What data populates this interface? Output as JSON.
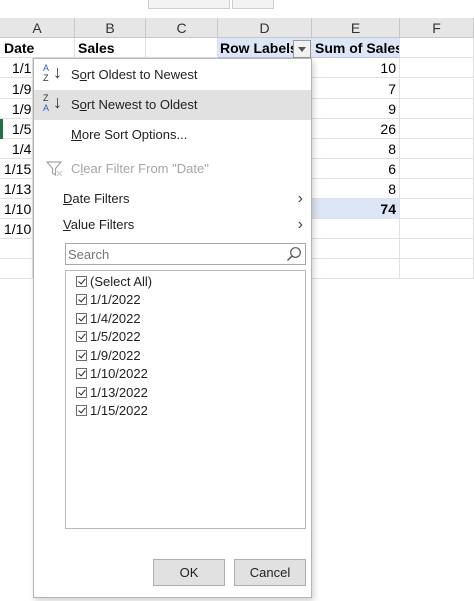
{
  "grid": {
    "columns": [
      "A",
      "B",
      "C",
      "D",
      "E",
      "F"
    ],
    "row1": {
      "a": "Date",
      "b": "Sales",
      "d": "Row Labels",
      "e": "Sum of Sales"
    },
    "colA_dates": [
      "1/1",
      "1/9",
      "1/9",
      "1/5",
      "1/4",
      "1/15",
      "1/13",
      "1/10",
      "1/10"
    ],
    "pivot_values": [
      "10",
      "7",
      "9",
      "26",
      "8",
      "6",
      "8"
    ],
    "grand_total": "74"
  },
  "menu": {
    "sort_asc": {
      "prefix": "S",
      "underline": "o",
      "rest": "rt Oldest to Newest"
    },
    "sort_desc": {
      "prefix": "S",
      "underline": "o",
      "rest": "rt Newest to Oldest"
    },
    "more_sort": {
      "underline": "M",
      "rest": "ore Sort Options..."
    },
    "clear_filter": {
      "prefix": "C",
      "underline": "l",
      "rest": "ear Filter From \"Date\""
    },
    "date_filters": {
      "underline": "D",
      "rest": "ate Filters"
    },
    "value_filters": {
      "underline": "V",
      "rest": "alue Filters"
    },
    "search_placeholder": "Search",
    "items": [
      "(Select All)",
      "1/1/2022",
      "1/4/2022",
      "1/5/2022",
      "1/9/2022",
      "1/10/2022",
      "1/13/2022",
      "1/15/2022"
    ],
    "ok_label": "OK",
    "cancel_label": "Cancel",
    "icons": {
      "sort_asc": "sort-a-to-z-icon",
      "sort_desc": "sort-z-to-a-icon",
      "clear": "funnel-clear-icon",
      "search": "magnifier-icon",
      "submenu": "chevron-right-icon",
      "filter": "dropdown-arrow-icon"
    }
  },
  "colors": {
    "accent": "#217346",
    "pivot_header": "#dde6f6",
    "hover": "#e1e1e1",
    "sort_blue": "#1f63c4"
  }
}
